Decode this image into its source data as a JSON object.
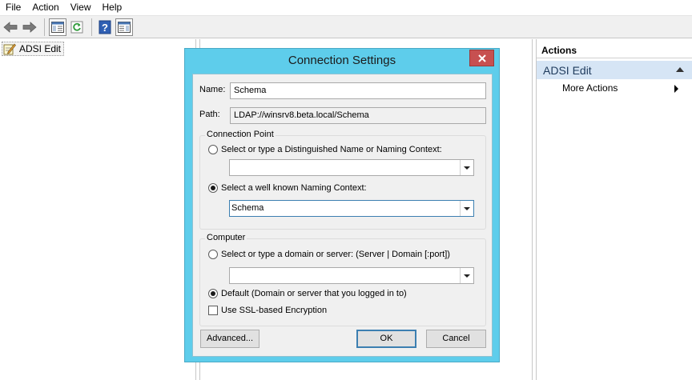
{
  "menu": [
    "File",
    "Action",
    "View",
    "Help"
  ],
  "tree": {
    "root_label": "ADSI Edit"
  },
  "actions_pane": {
    "title": "Actions",
    "section": "ADSI Edit",
    "items": [
      "More Actions"
    ]
  },
  "dialog": {
    "title": "Connection Settings",
    "name_label": "Name:",
    "name_value": "Schema",
    "path_label": "Path:",
    "path_value": "LDAP://winsrv8.beta.local/Schema",
    "connection_point": {
      "title": "Connection Point",
      "option_dn": "Select or type a Distinguished Name or Naming Context:",
      "dn_value": "",
      "option_well_known": "Select a well known Naming Context:",
      "well_known_value": "Schema",
      "selected": "well_known"
    },
    "computer": {
      "title": "Computer",
      "option_server": "Select or type a domain or server: (Server | Domain [:port])",
      "server_value": "",
      "option_default": "Default (Domain or server that you logged in to)",
      "selected": "default",
      "ssl_label": "Use SSL-based Encryption",
      "ssl_checked": false
    },
    "buttons": {
      "advanced": "Advanced...",
      "ok": "OK",
      "cancel": "Cancel"
    }
  },
  "colors": {
    "dialog_frame": "#5ecdeb",
    "close_button": "#c75050",
    "actions_section": "#d6e5f5"
  }
}
